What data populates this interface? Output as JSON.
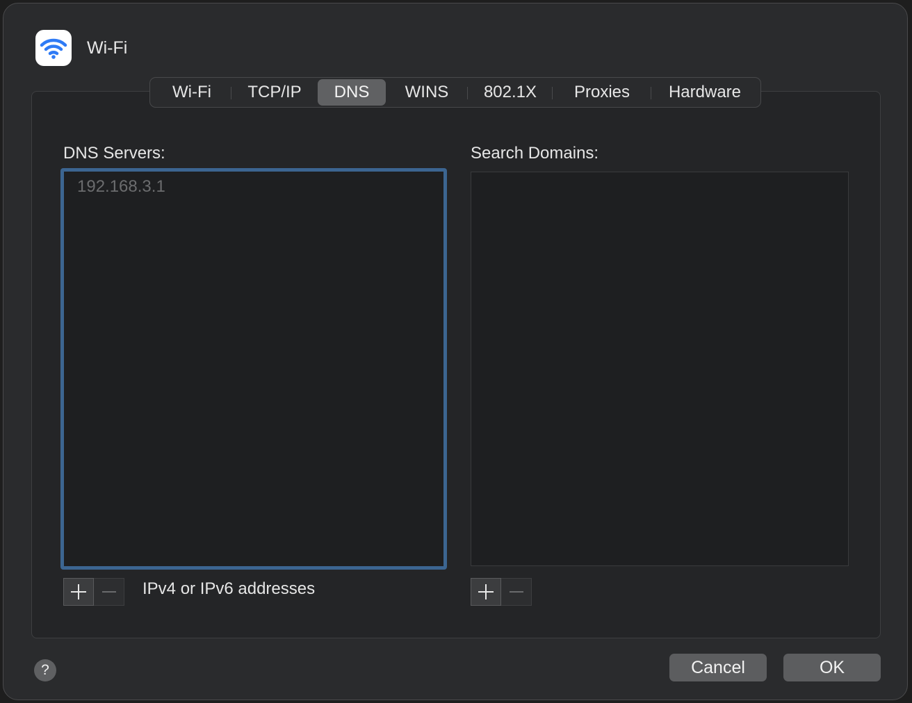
{
  "window": {
    "title": "Wi-Fi"
  },
  "tabs": [
    {
      "label": "Wi-Fi",
      "active": false
    },
    {
      "label": "TCP/IP",
      "active": false
    },
    {
      "label": "DNS",
      "active": true
    },
    {
      "label": "WINS",
      "active": false
    },
    {
      "label": "802.1X",
      "active": false
    },
    {
      "label": "Proxies",
      "active": false
    },
    {
      "label": "Hardware",
      "active": false
    }
  ],
  "dns": {
    "label": "DNS Servers:",
    "servers": [
      "192.168.3.1"
    ],
    "add_label": "+",
    "remove_label": "−",
    "hint": "IPv4 or IPv6 addresses"
  },
  "search": {
    "label": "Search Domains:",
    "domains": [],
    "add_label": "+",
    "remove_label": "−"
  },
  "footer": {
    "help_label": "?",
    "cancel_label": "Cancel",
    "ok_label": "OK"
  },
  "colors": {
    "accent": "#3c6591",
    "wifi_icon": "#2f7bf5"
  }
}
